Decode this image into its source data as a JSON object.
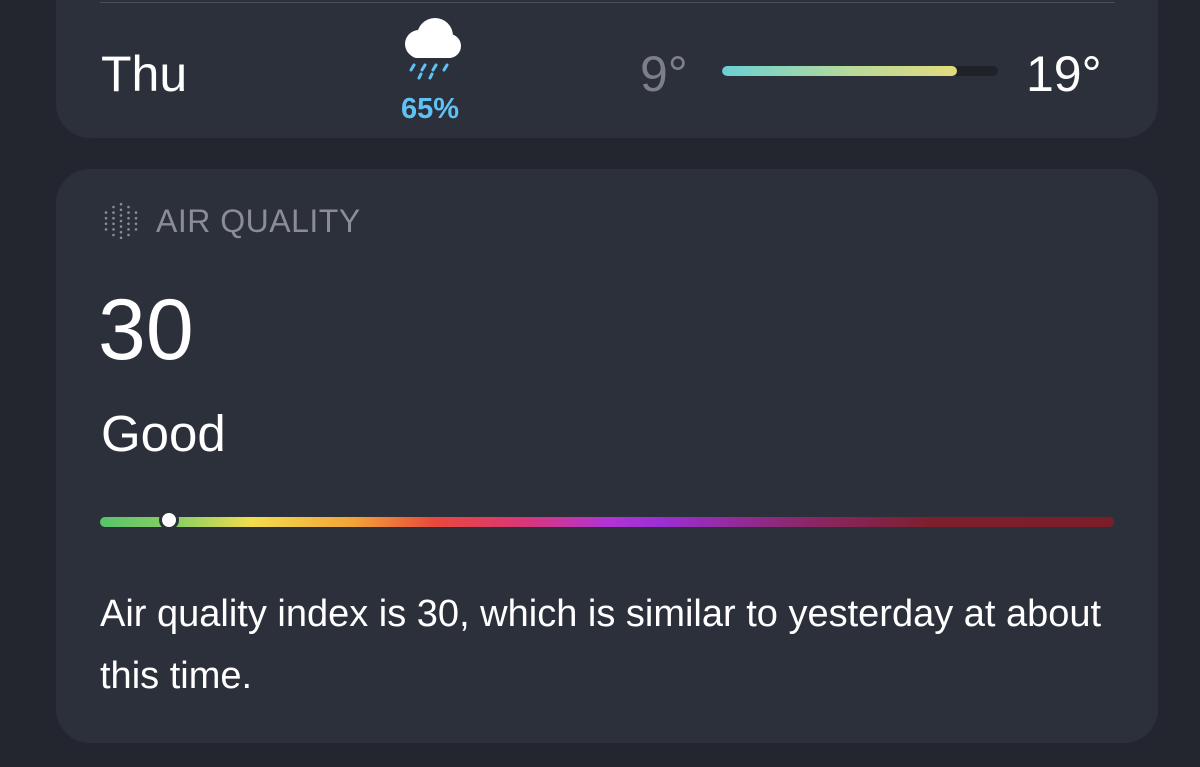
{
  "forecast_row": {
    "day": "Thu",
    "condition_icon": "cloud-rain-icon",
    "precipitation": "65%",
    "temp_low": "9°",
    "temp_high": "19°",
    "temp_range_fill": {
      "start_fraction": 0.0,
      "end_fraction": 0.85
    }
  },
  "air_quality": {
    "header_icon": "air-quality-dots-icon",
    "header_label": "AIR QUALITY",
    "value": "30",
    "category": "Good",
    "scale_position_fraction": 0.065,
    "description": "Air quality index is 30, which is similar to yesterday at about this time."
  },
  "colors": {
    "background": "#23262f",
    "card": "#2c303b",
    "precipitation_text": "#5ec3f4",
    "muted_text": "#8a8d96"
  }
}
